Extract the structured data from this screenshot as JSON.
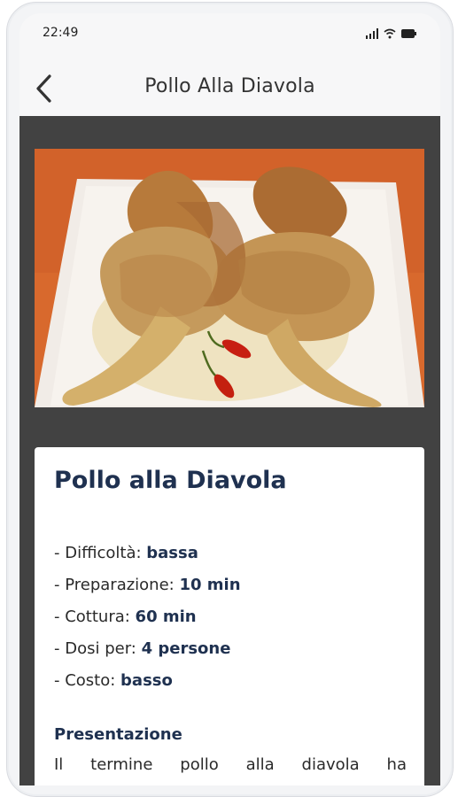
{
  "status_bar": {
    "time": "22:49",
    "icons": [
      "signal-icon",
      "wifi-icon",
      "battery-icon"
    ]
  },
  "app_bar": {
    "back_icon": "back-arrow-icon",
    "title": "Pollo Alla Diavola"
  },
  "recipe": {
    "image_alt": "Pollo alla diavola",
    "title": "Pollo alla Diavola",
    "info": [
      {
        "label": "- Difficoltà: ",
        "value": "bassa"
      },
      {
        "label": "- Preparazione: ",
        "value": "10 min"
      },
      {
        "label": "- Cottura: ",
        "value": "60 min"
      },
      {
        "label": "- Dosi per: ",
        "value": "4 persone"
      },
      {
        "label": "- Costo: ",
        "value": "basso"
      }
    ],
    "presentation_heading": "Presentazione",
    "presentation_text": "Il termine pollo alla diavola ha"
  },
  "colors": {
    "content_background": "#424242",
    "card_background": "#ffffff",
    "title_color": "#1f3150",
    "image_background": "#d66a2b"
  }
}
